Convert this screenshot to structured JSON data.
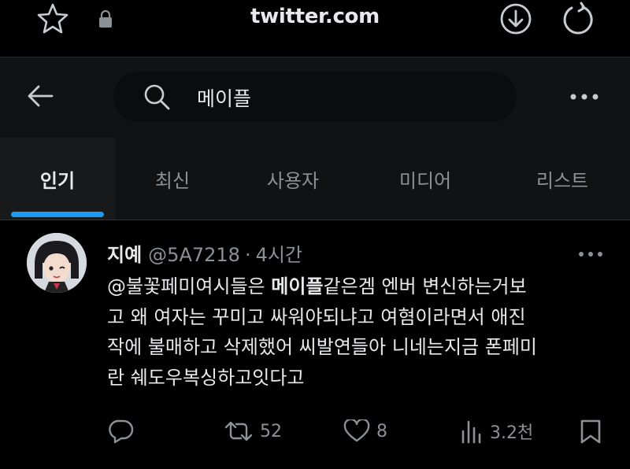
{
  "browser": {
    "url": "twitter.com",
    "icons": [
      "star-icon",
      "lock-icon",
      "download-icon",
      "reload-icon"
    ]
  },
  "search": {
    "query": "메이플",
    "icons": [
      "back-arrow-icon",
      "search-icon",
      "more-icon"
    ]
  },
  "tabs": [
    {
      "label": "인기",
      "active": true
    },
    {
      "label": "최신",
      "active": false
    },
    {
      "label": "사용자",
      "active": false
    },
    {
      "label": "미디어",
      "active": false
    },
    {
      "label": "리스트",
      "active": false
    }
  ],
  "tweet": {
    "author_name": "지예",
    "handle": "@5A7218",
    "separator": "·",
    "time": "4시간",
    "lines": [
      {
        "pre": "@불꽃페미여시들은 ",
        "highlight": "메이플",
        "post": "같은겜 엔버 변신하는거보"
      },
      {
        "text": "고 왜 여자는 꾸미고 싸워야되냐고 여혐이라면서 애진"
      },
      {
        "text": "작에 불매하고 삭제했어 씨발연들아 니네는지금 폰페미"
      },
      {
        "text": "란 쉐도우복싱하고잇다고"
      }
    ],
    "actions": {
      "reply_count": "",
      "retweet_count": "52",
      "like_count": "8",
      "view_count": "3.2천"
    }
  },
  "colors": {
    "background": "#000000",
    "header_background": "#101214",
    "accent": "#1d9bf0",
    "text_primary": "#e7e9ea",
    "text_secondary": "#8b9196"
  }
}
